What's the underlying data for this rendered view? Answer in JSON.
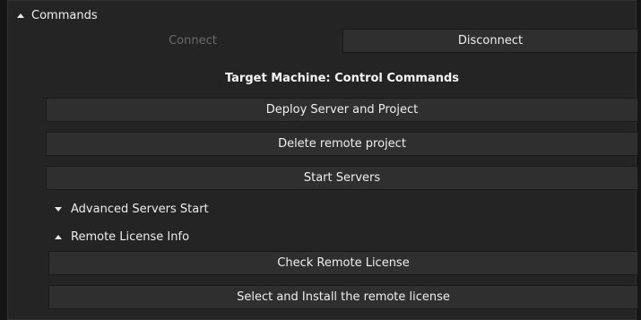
{
  "commands_section": {
    "title": "Commands",
    "expanded": true
  },
  "connection": {
    "connect_label": "Connect",
    "connect_enabled": false,
    "disconnect_label": "Disconnect"
  },
  "target_machine": {
    "heading": "Target Machine: Control Commands",
    "deploy_label": "Deploy Server and Project",
    "delete_label": "Delete remote project",
    "start_label": "Start Servers"
  },
  "advanced_servers": {
    "title": "Advanced Servers Start",
    "expanded": false
  },
  "remote_license": {
    "title": "Remote License Info",
    "expanded": true,
    "check_label": "Check Remote License",
    "install_label": "Select and Install the remote license"
  }
}
